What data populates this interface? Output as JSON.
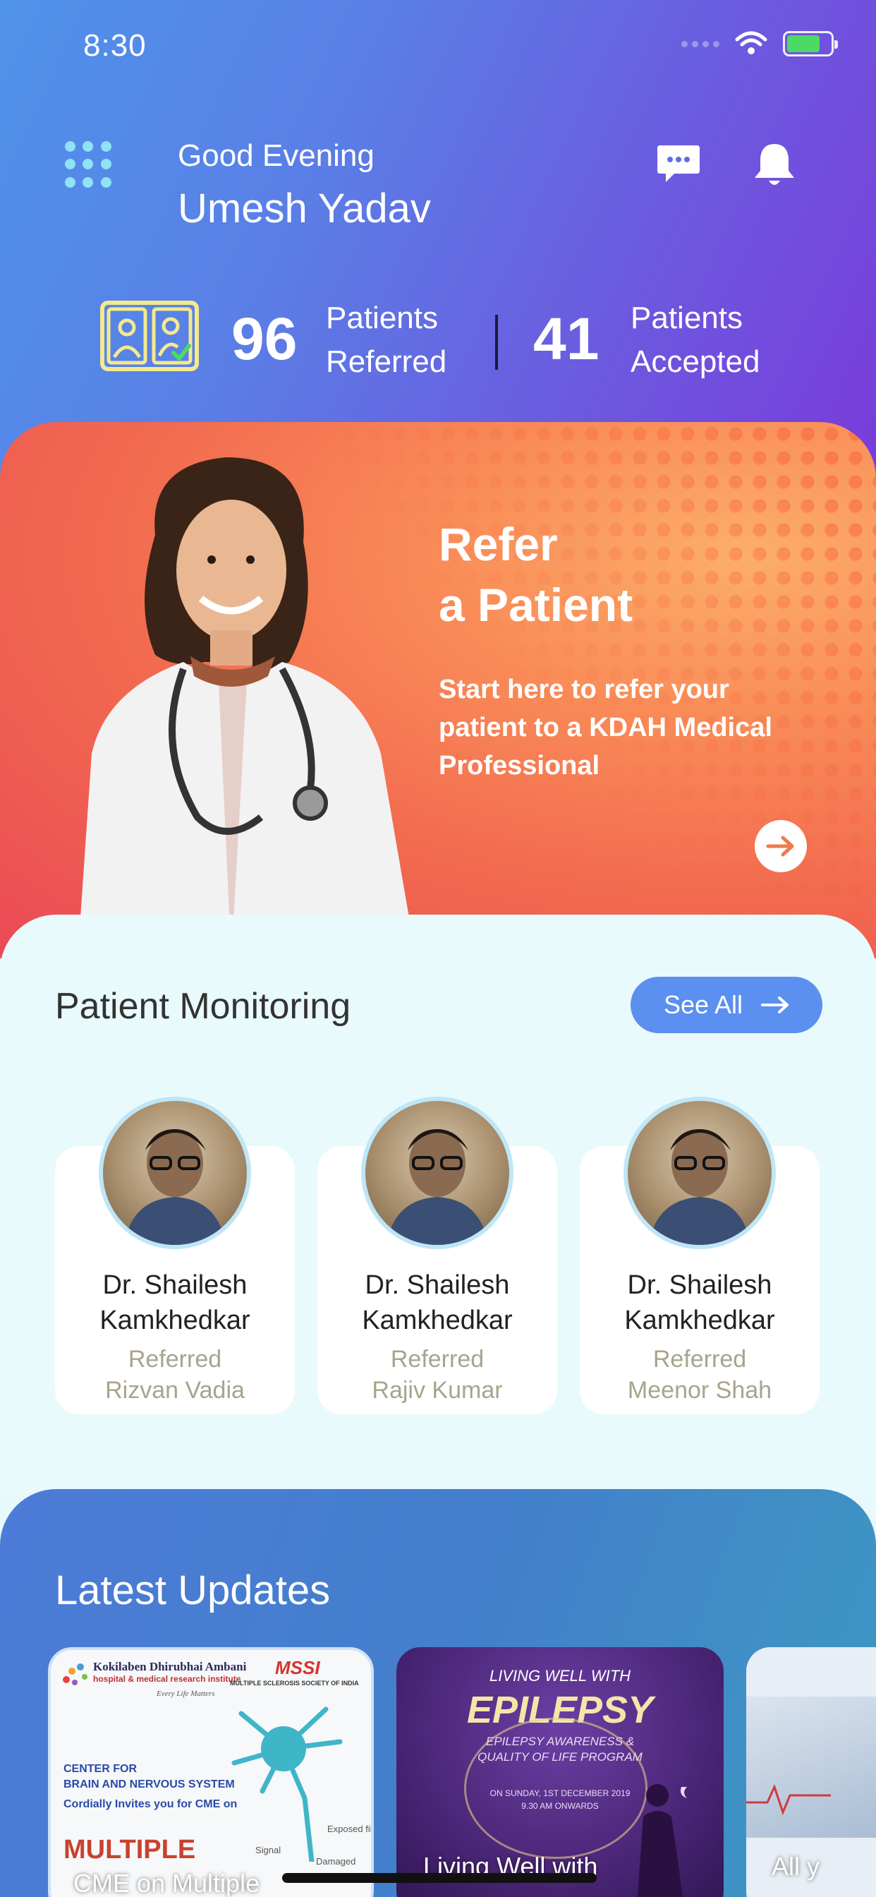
{
  "status_bar": {
    "time": "8:30"
  },
  "header": {
    "greeting": "Good Evening",
    "username": "Umesh Yadav"
  },
  "stats": {
    "referred_count": "96",
    "referred_label_1": "Patients",
    "referred_label_2": "Referred",
    "accepted_count": "41",
    "accepted_label_1": "Patients",
    "accepted_label_2": "Accepted"
  },
  "banner": {
    "title_line1": "Refer",
    "title_line2": "a Patient",
    "desc_line1": "Start here to refer your",
    "desc_line2": "patient to a KDAH Medical",
    "desc_line3": "Professional"
  },
  "monitoring": {
    "title": "Patient Monitoring",
    "see_all": "See All",
    "cards": [
      {
        "name_line1": "Dr. Shailesh",
        "name_line2": "Kamkhedkar",
        "ref_label": "Referred",
        "patient": "Rizvan Vadia"
      },
      {
        "name_line1": "Dr. Shailesh",
        "name_line2": "Kamkhedkar",
        "ref_label": "Referred",
        "patient": "Rajiv Kumar"
      },
      {
        "name_line1": "Dr. Shailesh",
        "name_line2": "Kamkhedkar",
        "ref_label": "Referred",
        "patient": "Meenor Shah"
      }
    ]
  },
  "updates": {
    "title": "Latest Updates",
    "cards": [
      {
        "org": "Kokilaben Dhirubhai Ambani",
        "org_sub": "hospital & medical research institute",
        "tagline": "Every Life Matters",
        "badge": "MSSI",
        "badge_sub": "MULTIPLE SCLEROSIS SOCIETY OF INDIA",
        "center_line1": "CENTER FOR",
        "center_line2": "BRAIN AND NERVOUS SYSTEM",
        "invite": "Cordially Invites you for CME on",
        "big": "MULTIPLE",
        "label_signal": "Signal",
        "label_exposed": "Exposed fiber",
        "label_damaged": "Damaged",
        "caption": "CME on Multiple"
      },
      {
        "top": "LIVING WELL WITH",
        "headline": "EPILEPSY",
        "sub_line1": "EPILEPSY AWARENESS &",
        "sub_line2": "QUALITY OF LIFE PROGRAM",
        "date_line1": "ON SUNDAY, 1ST DECEMBER 2019",
        "date_line2": "9.30 AM ONWARDS",
        "caption": "Living Well with"
      },
      {
        "caption": "All y"
      }
    ]
  },
  "colors": {
    "header_start": "#4f93ea",
    "header_end": "#7a3bd9",
    "banner": "#f26a4f",
    "accent_blue": "#5b8ff0",
    "monitor_bg": "#e9fafc"
  }
}
